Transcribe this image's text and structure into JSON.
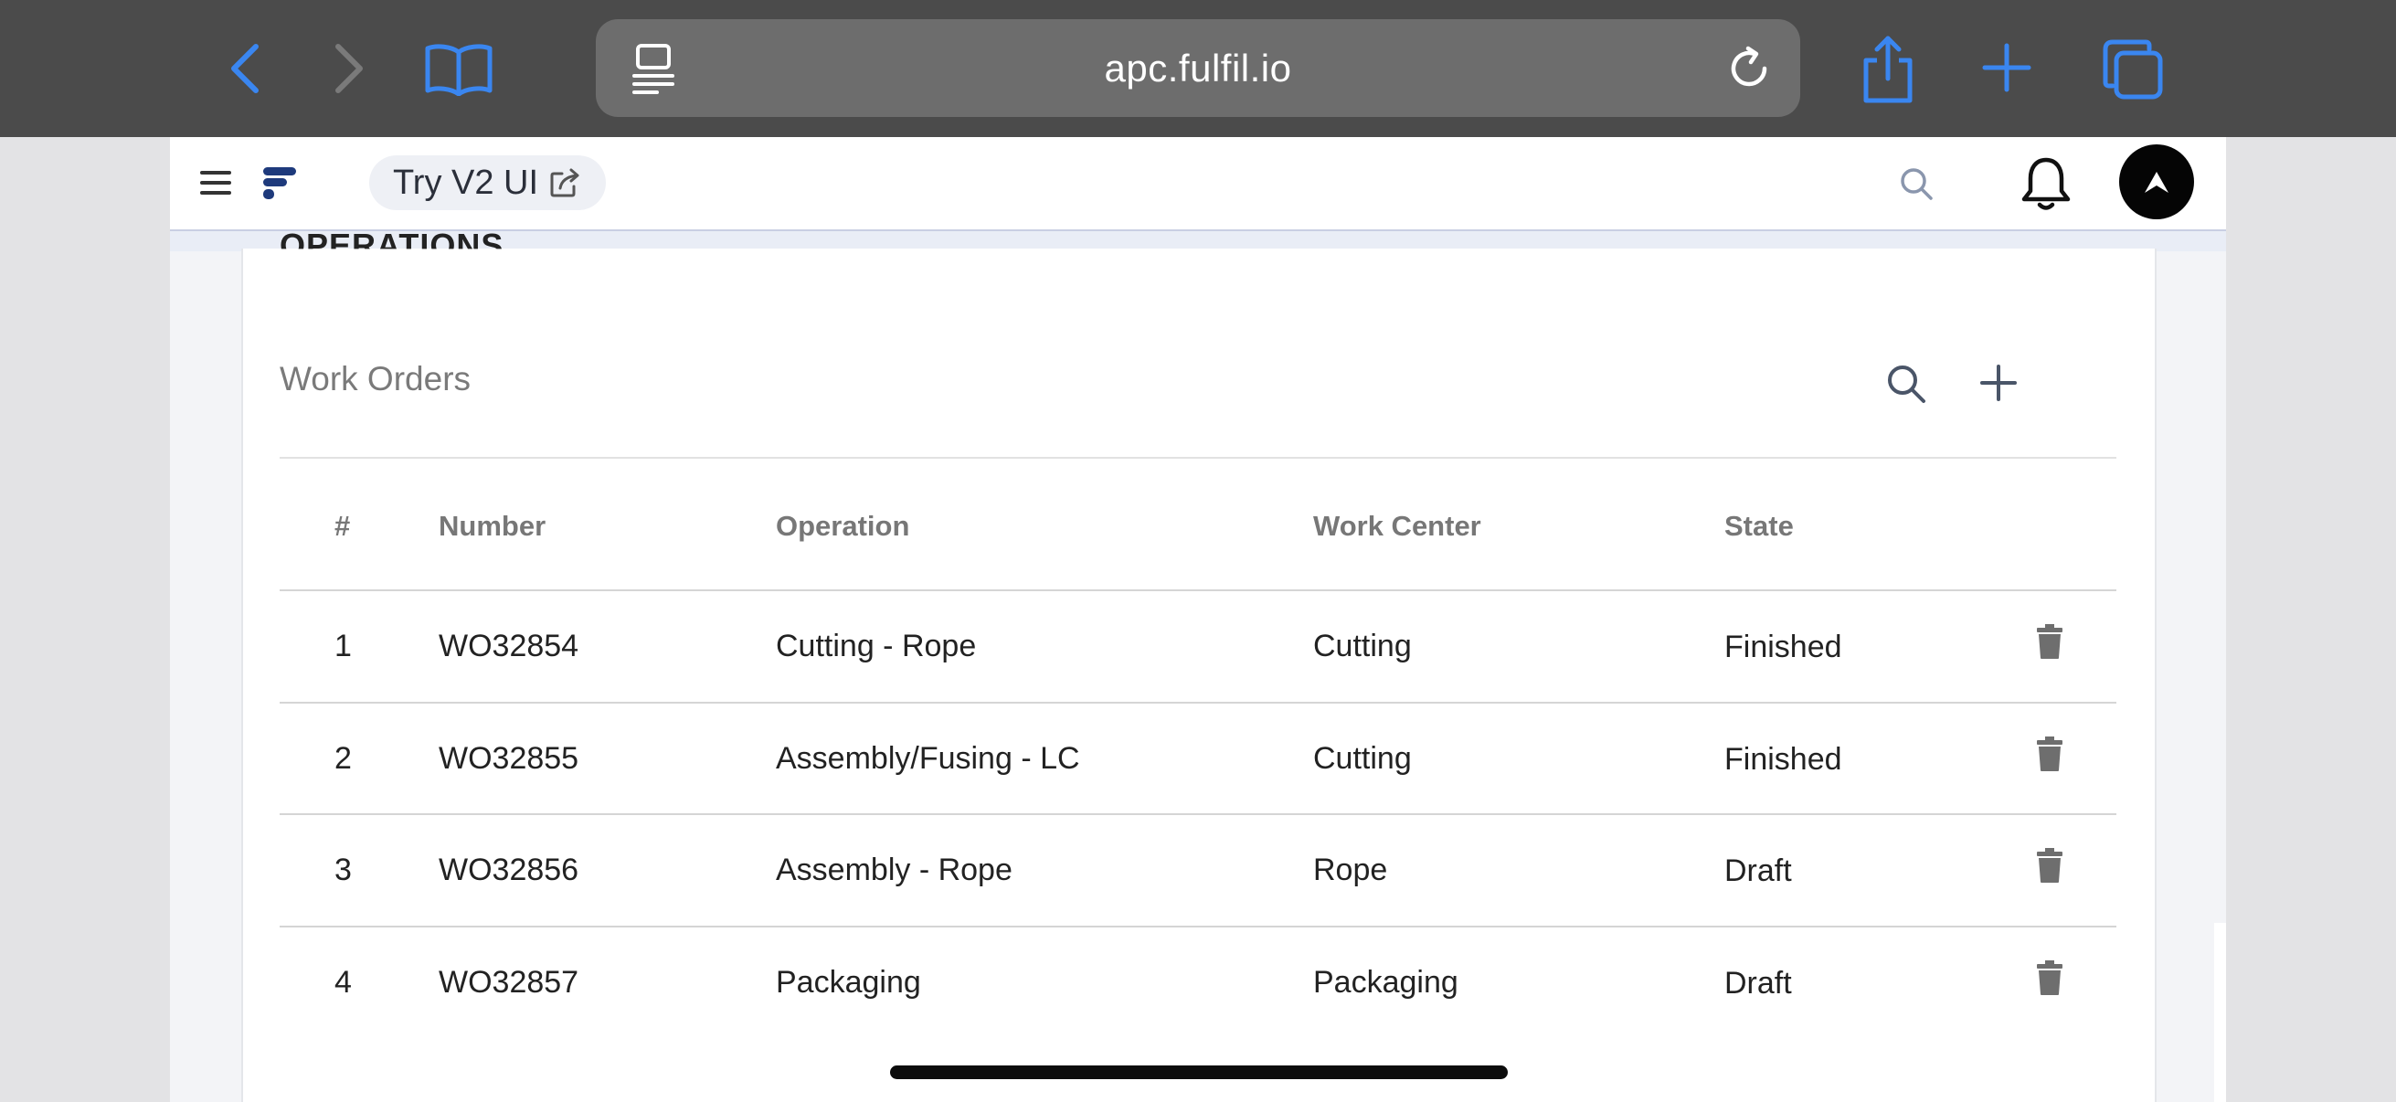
{
  "browser": {
    "url": "apc.fulfil.io",
    "accent_color": "#3a86f0",
    "icons": [
      "back-icon",
      "forward-icon",
      "bookmarks-icon",
      "reader-icon",
      "reload-icon",
      "share-icon",
      "new-tab-icon",
      "tabs-icon"
    ]
  },
  "app": {
    "try_v2_label": "Try V2 UI",
    "icons": [
      "menu-icon",
      "fulfil-logo",
      "external-link-icon",
      "search-icon",
      "bell-icon",
      "avatar"
    ]
  },
  "section": {
    "title": "OPERATIONS",
    "subsection_title": "Work Orders"
  },
  "table": {
    "columns": [
      "#",
      "Number",
      "Operation",
      "Work Center",
      "State"
    ],
    "rows": [
      {
        "index": "1",
        "number": "WO32854",
        "operation": "Cutting - Rope",
        "work_center": "Cutting",
        "state": "Finished"
      },
      {
        "index": "2",
        "number": "WO32855",
        "operation": "Assembly/Fusing - LC",
        "work_center": "Cutting",
        "state": "Finished"
      },
      {
        "index": "3",
        "number": "WO32856",
        "operation": "Assembly - Rope",
        "work_center": "Rope",
        "state": "Draft"
      },
      {
        "index": "4",
        "number": "WO32857",
        "operation": "Packaging",
        "work_center": "Packaging",
        "state": "Draft"
      }
    ]
  }
}
